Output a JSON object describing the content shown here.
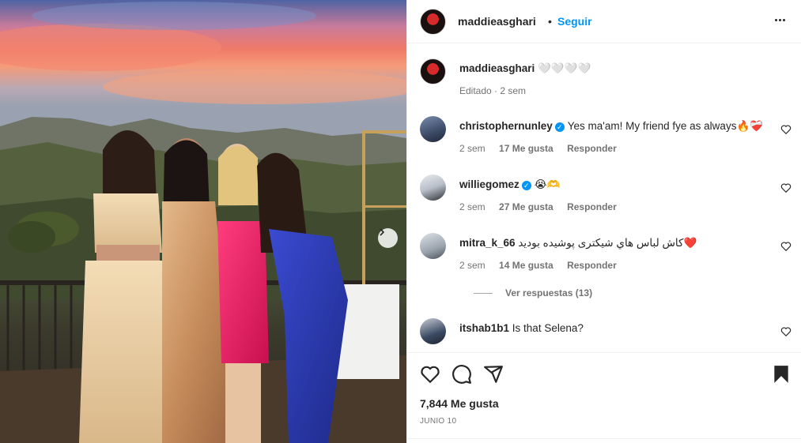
{
  "post": {
    "username": "maddieasghari",
    "dot": "•",
    "follow_label": "Seguir",
    "more_icon": "more-horizontal-icon"
  },
  "caption": {
    "username": "maddieasghari",
    "text": "🤍🤍🤍🤍",
    "edited": "Editado · 2 sem"
  },
  "comments": [
    {
      "username": "christophernunley",
      "verified": true,
      "text": "Yes ma'am! My friend fye as always🔥❤️‍🩹",
      "time": "2 sem",
      "likes": "17 Me gusta",
      "reply": "Responder"
    },
    {
      "username": "williegomez",
      "verified": true,
      "text": "😭🫶",
      "time": "2 sem",
      "likes": "27 Me gusta",
      "reply": "Responder"
    },
    {
      "username": "mitra_k_66",
      "verified": false,
      "text": "كاش لباس هاي شيكترى پوشيده بوديد❤️",
      "time": "2 sem",
      "likes": "14 Me gusta",
      "reply": "Responder"
    },
    {
      "username": "itshab1b1",
      "verified": false,
      "text": "Is that Selena?",
      "time": "",
      "likes": "",
      "reply": ""
    }
  ],
  "view_replies": "Ver respuestas (13)",
  "likes_count": "7,844 Me gusta",
  "post_date": "JUNIO 10",
  "icons": {
    "like": "heart-icon",
    "comment": "comment-icon",
    "share": "share-icon",
    "save": "bookmark-icon",
    "next": "chevron-right-icon"
  }
}
